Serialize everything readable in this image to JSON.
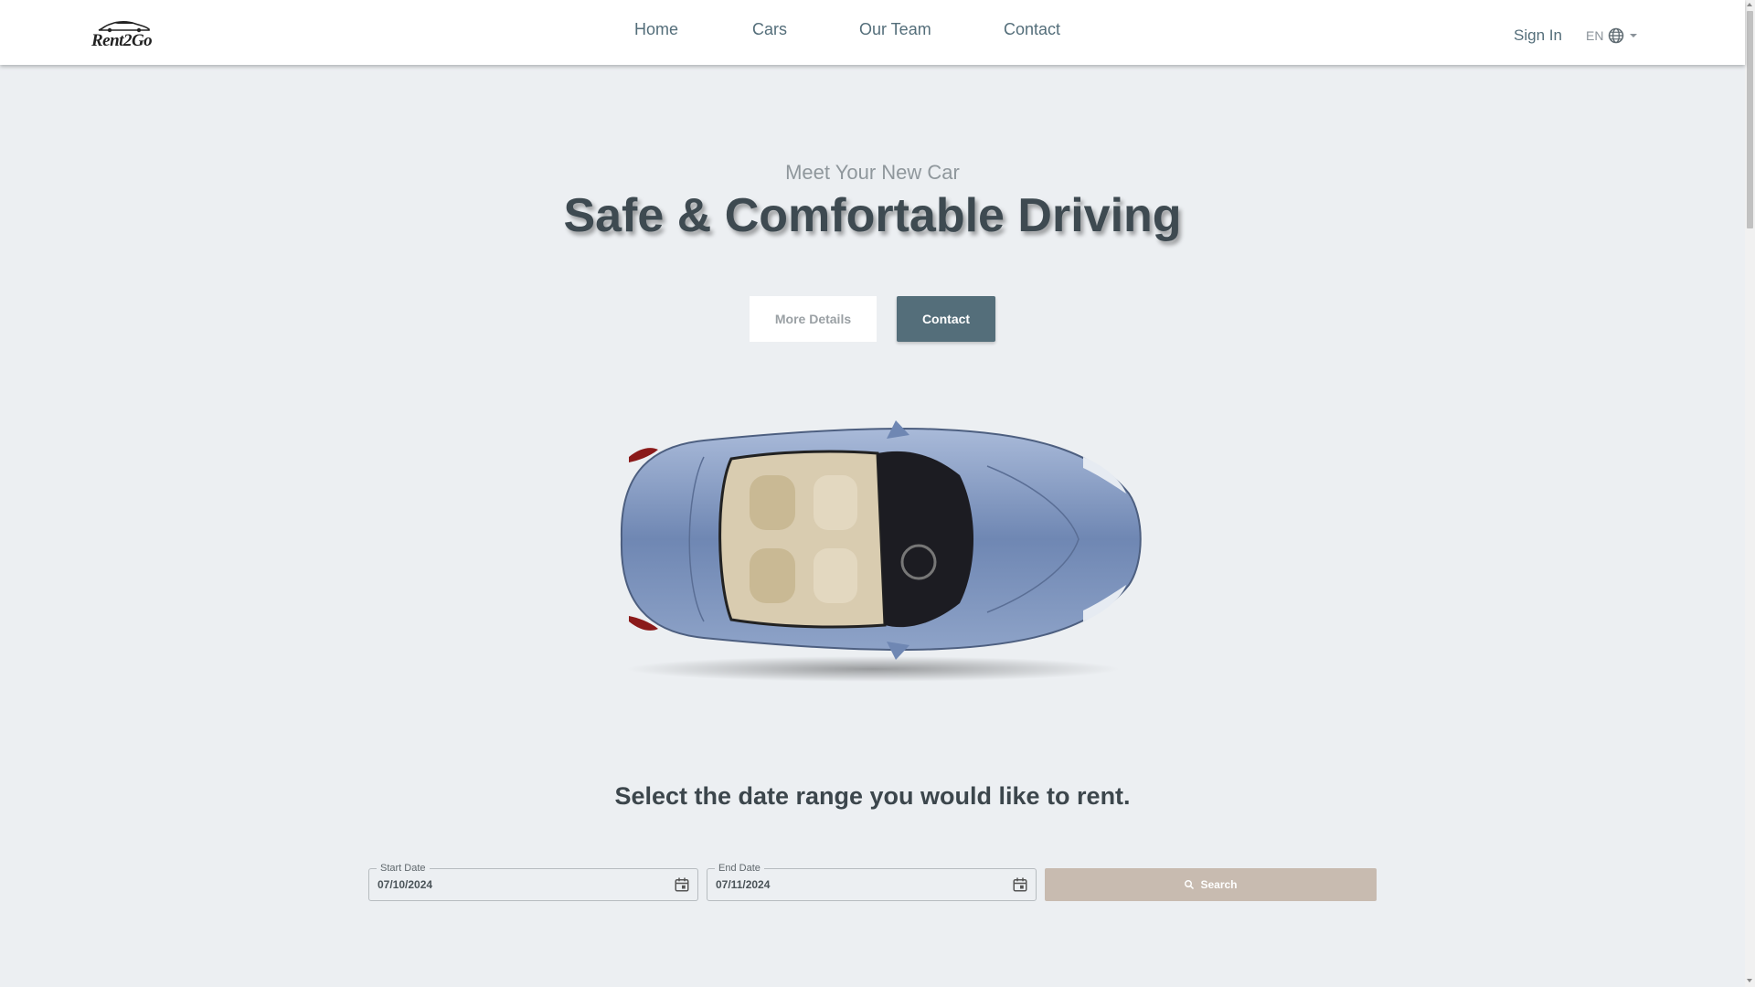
{
  "header": {
    "logo_text": "Rent2Go",
    "nav": [
      {
        "label": "Home"
      },
      {
        "label": "Cars"
      },
      {
        "label": "Our Team"
      },
      {
        "label": "Contact"
      }
    ],
    "sign_in": "Sign In",
    "language": "EN",
    "language_icon": "globe-icon"
  },
  "hero": {
    "subtitle": "Meet Your New Car",
    "title": "Safe & Comfortable Driving",
    "more_details_label": "More Details",
    "contact_label": "Contact",
    "car_color": "#7890b8"
  },
  "booking": {
    "heading": "Select the date range you would like to rent.",
    "start_label": "Start Date",
    "start_value": "07/10/2024",
    "end_label": "End Date",
    "end_value": "07/11/2024",
    "search_label": "Search",
    "calendar_icon": "calendar-icon",
    "search_icon": "search-icon"
  },
  "colors": {
    "background": "#eceff2",
    "primary": "#546e7a",
    "search_button": "#c8bbb0"
  }
}
